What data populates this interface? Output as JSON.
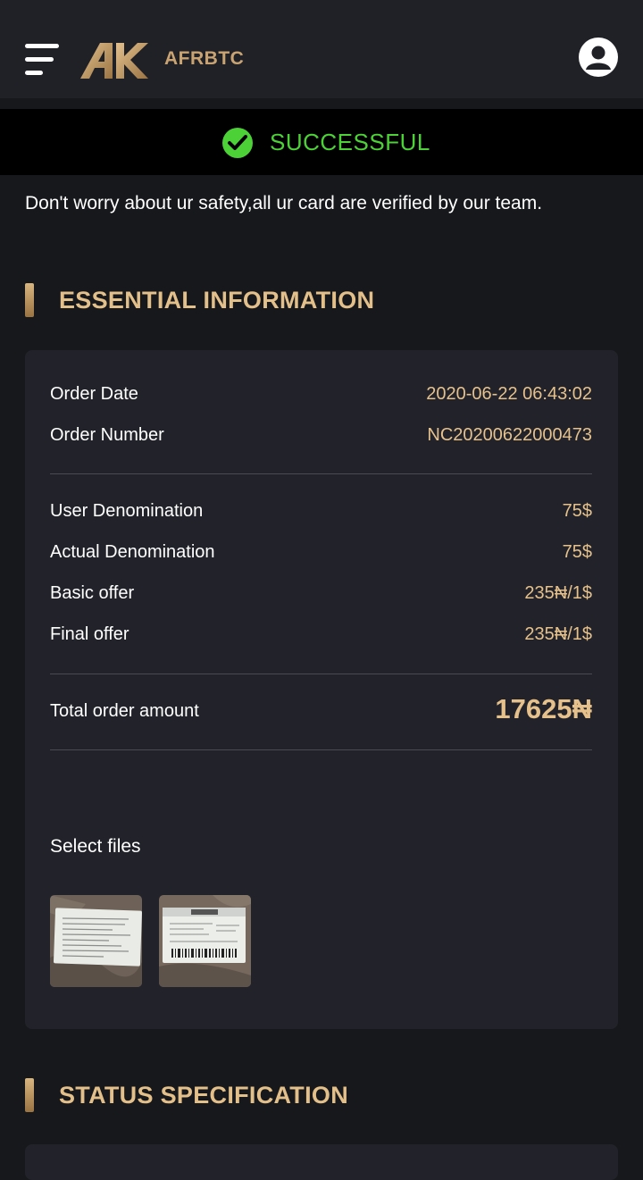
{
  "header": {
    "brand": "AFRBTC"
  },
  "status": {
    "text": "SUCCESSFUL"
  },
  "notice": "Don't worry about ur safety,all ur card are verified by our team.",
  "sections": {
    "essential": "ESSENTIAL INFORMATION",
    "status_spec": "STATUS SPECIFICATION"
  },
  "order": {
    "date_label": "Order Date",
    "date_value": "2020-06-22 06:43:02",
    "number_label": "Order Number",
    "number_value": "NC20200622000473",
    "user_denom_label": "User Denomination",
    "user_denom_value": "75$",
    "actual_denom_label": "Actual Denomination",
    "actual_denom_value": "75$",
    "basic_offer_label": "Basic offer",
    "basic_offer_value": "235₦/1$",
    "final_offer_label": "Final offer",
    "final_offer_value": "235₦/1$",
    "total_label": "Total order amount",
    "total_value": "17625₦",
    "files_label": "Select files"
  },
  "colors": {
    "accent_gold": "#e6c18c",
    "success_green": "#4cd137",
    "background": "#17181c",
    "card": "#22232a"
  }
}
